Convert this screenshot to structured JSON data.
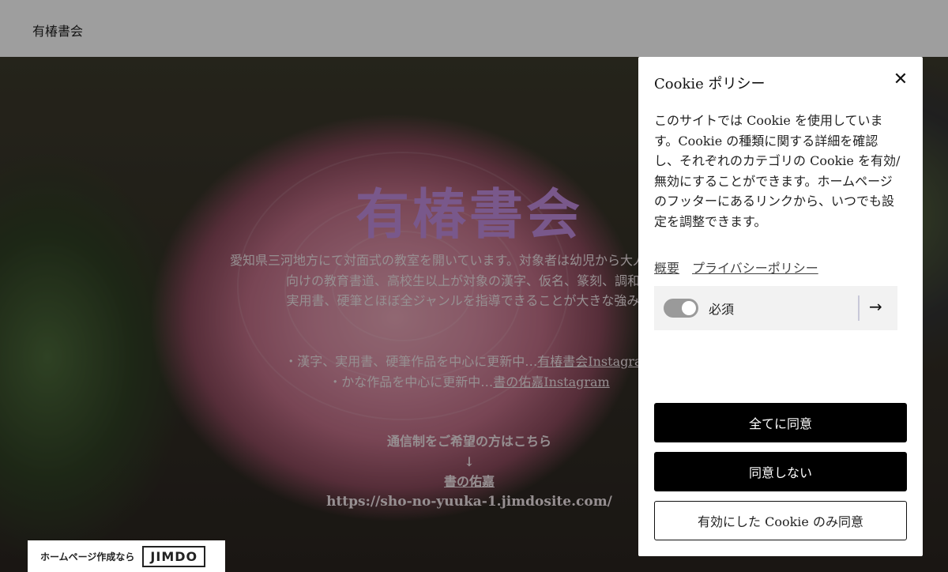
{
  "header": {
    "site_name": "有椿書会"
  },
  "hero": {
    "title": "有椿書会",
    "intro_lines": [
      "愛知県三河地方にて対面式の教室を開いています。対象者は幼児から大人まで幅広く",
      "向けの教育書道、高校生以上が対象の漢字、仮名、篆刻、調和体",
      "実用書、硬筆とほぼ全ジャンルを指導できることが大きな強みで"
    ],
    "insta_line1_prefix": "・漢字、実用書、硬筆作品を中心に更新中…",
    "insta_line1_link": "有椿書会Instagram",
    "insta_line2_prefix": "・かな作品を中心に更新中…",
    "insta_line2_link": "書の佑嘉Instagram",
    "correspondence_heading": "通信制をご希望の方はこちら",
    "down_arrow": "↓",
    "correspondence_link": "書の佑嘉",
    "correspondence_url": "https://sho-no-yuuka-1.jimdosite.com/"
  },
  "jimdo_badge": {
    "text": "ホームページ作成なら",
    "logo": "JIMDO"
  },
  "cookie_panel": {
    "title": "Cookie ポリシー",
    "close_icon": "close-icon",
    "description": "このサイトでは Cookie を使用しています。Cookie の種類に関する詳細を確認し、それぞれのカテゴリの Cookie を有効/無効にすることができます。ホームページのフッターにあるリンクから、いつでも設定を調整できます。",
    "links": {
      "overview": "概要",
      "privacy": "プライバシーポリシー"
    },
    "category": {
      "label": "必須",
      "enabled": true,
      "arrow_icon": "arrow-right-icon"
    },
    "buttons": {
      "accept_all": "全てに同意",
      "decline": "同意しない",
      "accept_selected": "有効にした Cookie のみ同意"
    }
  }
}
